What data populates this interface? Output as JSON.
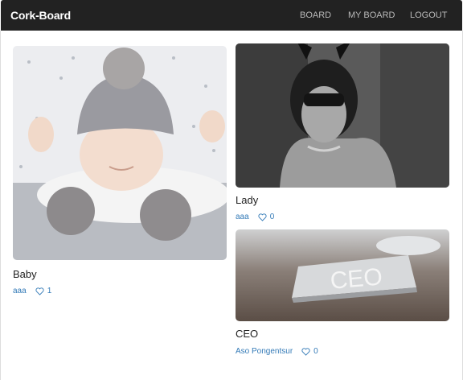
{
  "navbar": {
    "brand": "Cork-Board",
    "links": [
      "BOARD",
      "MY BOARD",
      "LOGOUT"
    ]
  },
  "cards": [
    {
      "title": "Baby",
      "author": "aaa",
      "likes": "1",
      "image": "photo of a sleeping baby in a grey knit hat"
    },
    {
      "title": "Lady",
      "author": "aaa",
      "likes": "0",
      "image": "black and white photo of a woman in a bunny mask"
    },
    {
      "title": "CEO",
      "author": "Aso Pongentsur",
      "likes": "0",
      "image": "photo of a CEO desk name plate"
    }
  ],
  "colors": {
    "navbar": "#222222",
    "link": "#337ab7",
    "nav_text": "#b9b9b9"
  },
  "icons": {
    "like": "heart-outline-icon"
  }
}
